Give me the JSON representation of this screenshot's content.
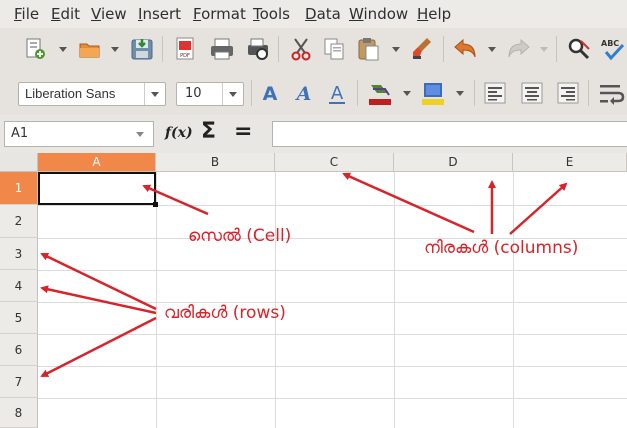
{
  "menu": {
    "items": [
      {
        "mnemonic": "F",
        "rest": "ile"
      },
      {
        "mnemonic": "E",
        "rest": "dit"
      },
      {
        "mnemonic": "V",
        "rest": "iew"
      },
      {
        "mnemonic": "I",
        "rest": "nsert"
      },
      {
        "mnemonic": "F",
        "rest": "ormat"
      },
      {
        "mnemonic": "T",
        "rest": "ools"
      },
      {
        "mnemonic": "D",
        "rest": "ata"
      },
      {
        "mnemonic": "W",
        "rest": "indow"
      },
      {
        "mnemonic": "H",
        "rest": "elp"
      }
    ]
  },
  "toolbar": {
    "icons": [
      "new-document-icon",
      "open-folder-icon",
      "save-icon",
      "export-pdf-icon",
      "print-icon",
      "print-preview-icon",
      "cut-icon",
      "copy-icon",
      "paste-icon",
      "clone-formatting-icon",
      "undo-icon",
      "redo-icon",
      "find-replace-icon",
      "spellcheck-icon"
    ],
    "pdf_label": "PDF",
    "abc_label": "ABC"
  },
  "formatting": {
    "font_name": "Liberation Sans",
    "font_size": "10",
    "icons": [
      "bold-icon",
      "italic-icon",
      "underline-icon",
      "font-color-icon",
      "highlight-icon",
      "align-left-icon",
      "align-center-icon",
      "align-right-icon",
      "wrap-text-icon"
    ],
    "bold_glyph": "A",
    "italic_glyph": "A",
    "underline_glyph": "A"
  },
  "formula_bar": {
    "cell_reference": "A1",
    "function_wizard": "f(x)",
    "sum": "Σ",
    "equals": "=",
    "content": ""
  },
  "sheet": {
    "columns": [
      "A",
      "B",
      "C",
      "D",
      "E"
    ],
    "rows": [
      "1",
      "2",
      "3",
      "4",
      "5",
      "6",
      "7",
      "8"
    ],
    "active_column": "A",
    "active_row": "1"
  },
  "annotations": {
    "cell": "സെൽ (Cell)",
    "columns": "നിരകൾ (columns)",
    "rows": "വരികൾ (rows)"
  },
  "colors": {
    "annotation_red": "#d9232a",
    "active_header": "#f2874a"
  }
}
